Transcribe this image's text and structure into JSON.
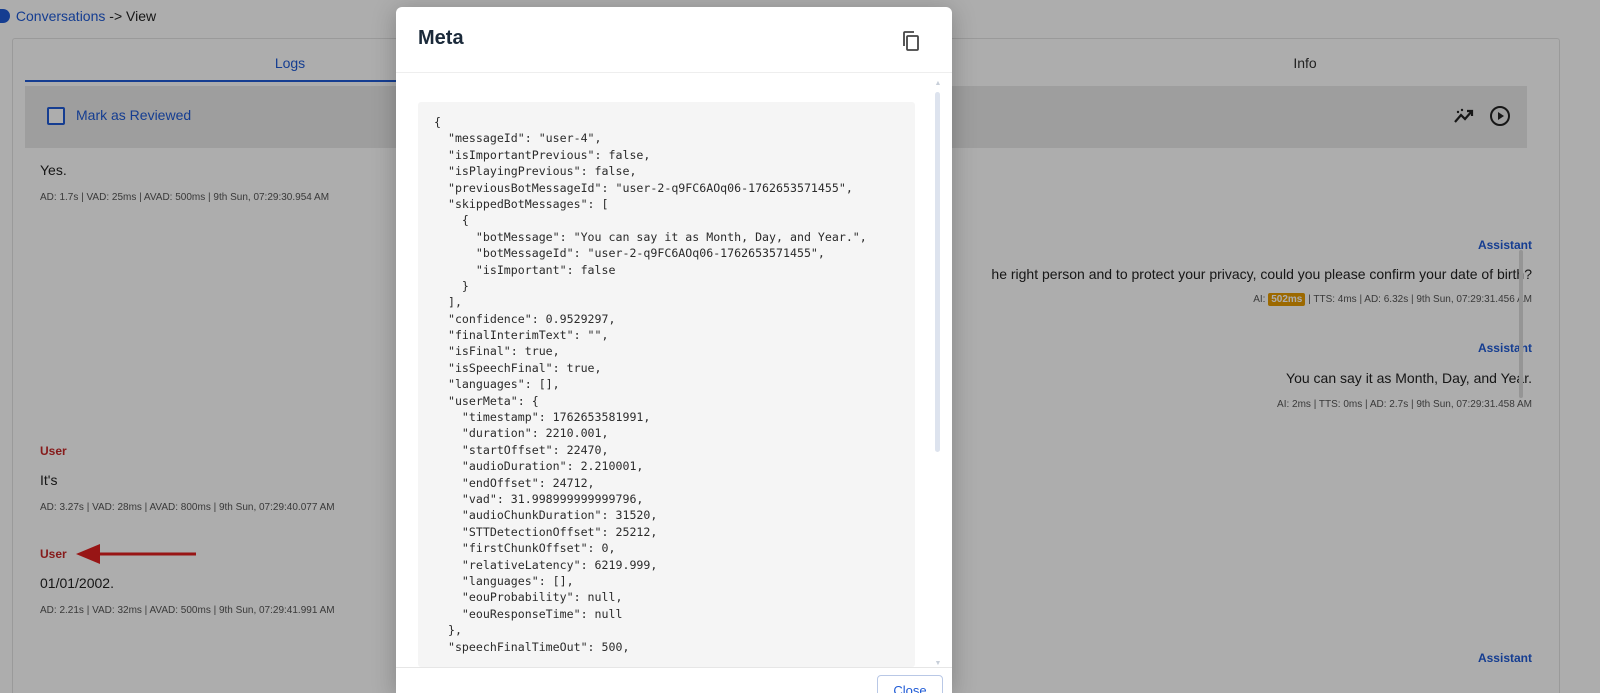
{
  "breadcrumb": {
    "link": "Conversations",
    "separator": "->",
    "current": "View"
  },
  "tabs": [
    {
      "label": "Logs",
      "active": true
    },
    {
      "label": "Info",
      "active": false
    }
  ],
  "toolbar": {
    "mark_reviewed_label": "Mark as Reviewed",
    "checked": false
  },
  "messages": {
    "m1": {
      "text": "Yes.",
      "meta": "AD: 1.7s | VAD:  25ms  | AVAD:  500ms  | 9th Sun, 07:29:30.954 AM"
    },
    "a1": {
      "role": "Assistant",
      "text": "he right person and to protect your privacy, could you please confirm your date of birth?",
      "meta_prefix": "AI:",
      "meta_highlight": "502ms",
      "meta_suffix": "| TTS:  4ms  | AD: 6.32s | 9th Sun, 07:29:31.456 AM"
    },
    "a2": {
      "role": "Assistant",
      "text": "You can say it as Month, Day, and Year.",
      "meta": "AI:  2ms  | TTS:  0ms  | AD: 2.7s | 9th Sun, 07:29:31.458 AM"
    },
    "u1": {
      "role": "User",
      "text": "It's",
      "meta": "AD: 3.27s | VAD:  28ms  | AVAD:  800ms  | 9th Sun, 07:29:40.077 AM"
    },
    "u2": {
      "role": "User",
      "text": "01/01/2002.",
      "meta": "AD: 2.21s | VAD:  32ms  | AVAD:  500ms  | 9th Sun, 07:29:41.991 AM"
    },
    "a3": {
      "role": "Assistant"
    }
  },
  "colors": {
    "accent": "#1f5bd6",
    "user_role": "#c62828",
    "arrow": "#e02020",
    "highlight": "#e69b00"
  },
  "modal": {
    "title": "Meta",
    "copy_icon": "copy-icon",
    "close_label": "Close",
    "json_lines": [
      "{",
      "  \"messageId\": \"user-4\",",
      "  \"isImportantPrevious\": false,",
      "  \"isPlayingPrevious\": false,",
      "  \"previousBotMessageId\": \"user-2-q9FC6AOq06-1762653571455\",",
      "  \"skippedBotMessages\": [",
      "    {",
      "      \"botMessage\": \"You can say it as Month, Day, and Year.\",",
      "      \"botMessageId\": \"user-2-q9FC6AOq06-1762653571455\",",
      "      \"isImportant\": false",
      "    }",
      "  ],",
      "  \"confidence\": 0.9529297,",
      "  \"finalInterimText\": \"\",",
      "  \"isFinal\": true,",
      "  \"isSpeechFinal\": true,",
      "  \"languages\": [],",
      "  \"userMeta\": {",
      "    \"timestamp\": 1762653581991,",
      "    \"duration\": 2210.001,",
      "    \"startOffset\": 22470,",
      "    \"audioDuration\": 2.210001,",
      "    \"endOffset\": 24712,",
      "    \"vad\": 31.998999999999796,",
      "    \"audioChunkDuration\": 31520,",
      "    \"STTDetectionOffset\": 25212,",
      "    \"firstChunkOffset\": 0,",
      "    \"relativeLatency\": 6219.999,",
      "    \"languages\": [],",
      "    \"eouProbability\": null,",
      "    \"eouResponseTime\": null",
      "  },",
      "  \"speechFinalTimeOut\": 500,"
    ]
  }
}
